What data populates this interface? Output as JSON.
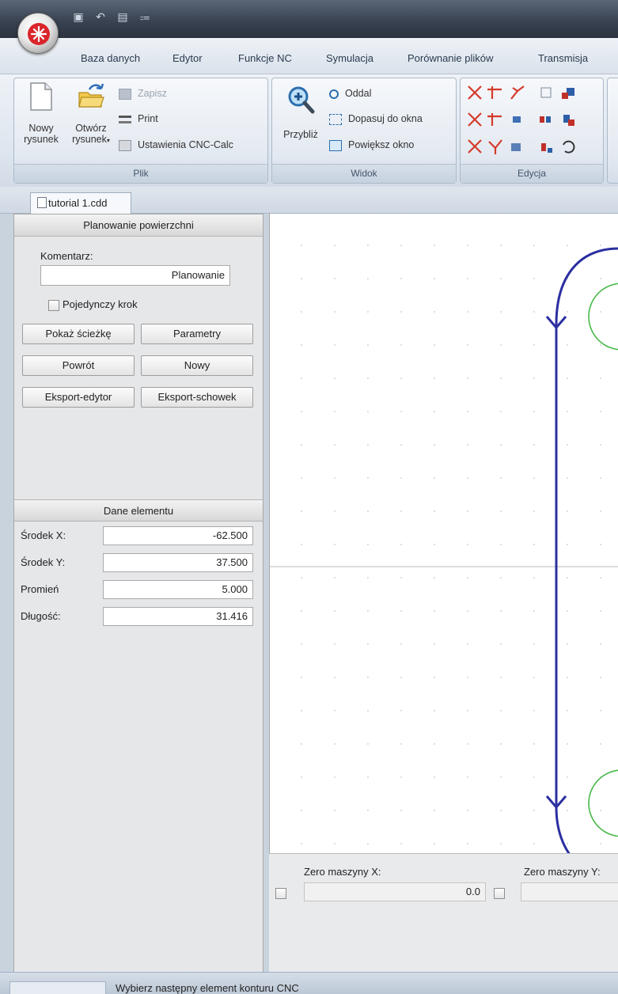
{
  "menu": {
    "tabs": [
      "Baza danych",
      "Edytor",
      "Funkcje NC",
      "Symulacja",
      "Porównanie plików",
      "Transmisja"
    ]
  },
  "ribbon": {
    "plik": {
      "title": "Plik",
      "new_line1": "Nowy",
      "new_line2": "rysunek",
      "open_line1": "Otwórz",
      "open_line2": "rysunek",
      "save": "Zapisz",
      "print": "Print",
      "settings": "Ustawienia CNC-Calc"
    },
    "widok": {
      "title": "Widok",
      "zoom_in": "Przybliż",
      "zoom_out": "Oddal",
      "fit": "Dopasuj do okna",
      "zoom_window": "Powiększ okno"
    },
    "edycja": {
      "title": "Edycja"
    }
  },
  "document": {
    "tab": "tutorial 1.cdd"
  },
  "panel_planowanie": {
    "title": "Planowanie powierzchni",
    "comment_label": "Komentarz:",
    "comment_value": "Planowanie",
    "single_step": "Pojedynczy krok",
    "show_path": "Pokaż ścieżkę",
    "parameters": "Parametry",
    "back": "Powrót",
    "new": "Nowy",
    "export_editor": "Eksport-edytor",
    "export_clipboard": "Eksport-schowek"
  },
  "panel_element": {
    "title": "Dane elementu",
    "rows": [
      {
        "label": "Środek X:",
        "value": "-62.500"
      },
      {
        "label": "Środek Y:",
        "value": "37.500"
      },
      {
        "label": "Promień",
        "value": "5.000"
      },
      {
        "label": "Długość:",
        "value": "31.416"
      }
    ]
  },
  "zero": {
    "x_label": "Zero maszyny X:",
    "x_value": "0.0",
    "y_label": "Zero maszyny Y:"
  },
  "status": {
    "text": "Wybierz następny element konturu CNC"
  },
  "colors": {
    "path": "#2b2fa0",
    "circle": "#48b94a",
    "axis": "#b9b9b9",
    "cut": "#d43a2a"
  }
}
